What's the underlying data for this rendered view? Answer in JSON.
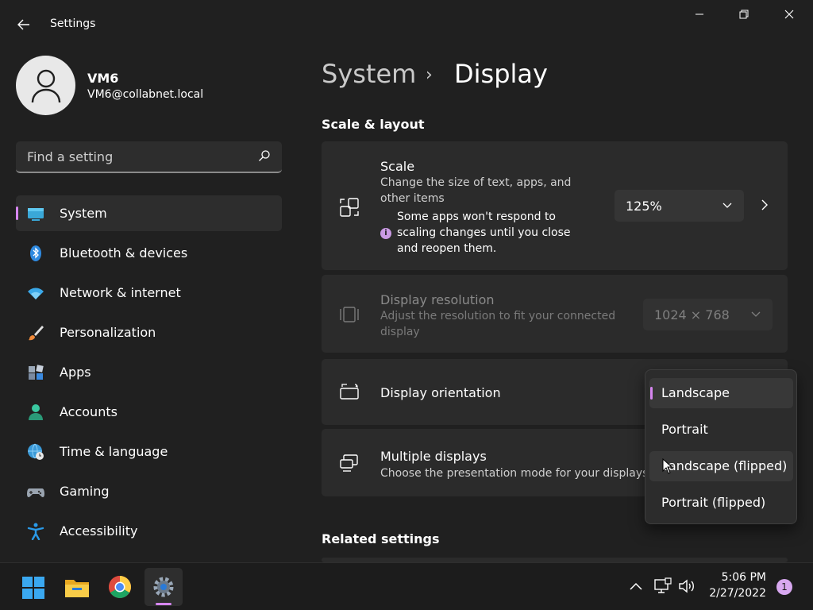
{
  "window": {
    "title": "Settings",
    "back_icon": "arrow-left-icon",
    "controls": [
      "minimize-icon",
      "restore-icon",
      "close-icon"
    ]
  },
  "profile": {
    "name": "VM6",
    "email": "VM6@collabnet.local"
  },
  "search": {
    "placeholder": "Find a setting",
    "icon": "search-icon"
  },
  "sidebar": {
    "items": [
      {
        "label": "System",
        "icon": "system-icon",
        "selected": true
      },
      {
        "label": "Bluetooth & devices",
        "icon": "bluetooth-icon"
      },
      {
        "label": "Network & internet",
        "icon": "wifi-icon"
      },
      {
        "label": "Personalization",
        "icon": "brush-icon"
      },
      {
        "label": "Apps",
        "icon": "apps-icon"
      },
      {
        "label": "Accounts",
        "icon": "accounts-icon"
      },
      {
        "label": "Time & language",
        "icon": "globe-clock-icon"
      },
      {
        "label": "Gaming",
        "icon": "gamepad-icon"
      },
      {
        "label": "Accessibility",
        "icon": "accessibility-icon"
      }
    ]
  },
  "breadcrumb": {
    "parent": "System",
    "separator": "›",
    "current": "Display"
  },
  "sections": {
    "scale_layout": "Scale & layout",
    "related": "Related settings"
  },
  "scale": {
    "title": "Scale",
    "description": "Change the size of text, apps, and other items",
    "note": "Some apps won't respond to scaling changes until you close and reopen them.",
    "value": "125%"
  },
  "resolution": {
    "title": "Display resolution",
    "description": "Adjust the resolution to fit your connected display",
    "value": "1024 × 768"
  },
  "orientation": {
    "title": "Display orientation",
    "options": [
      "Landscape",
      "Portrait",
      "Landscape (flipped)",
      "Portrait (flipped)"
    ],
    "selected": "Landscape"
  },
  "multiple": {
    "title": "Multiple displays",
    "description": "Choose the presentation mode for your displays"
  },
  "taskbar": {
    "apps": [
      "windows-start-icon",
      "file-explorer-icon",
      "chrome-icon",
      "settings-gear-icon"
    ],
    "time": "5:06 PM",
    "date": "2/27/2022",
    "notifications": "1"
  },
  "colors": {
    "accent": "#d686f0",
    "background": "#202020",
    "card": "#2b2b2b"
  }
}
